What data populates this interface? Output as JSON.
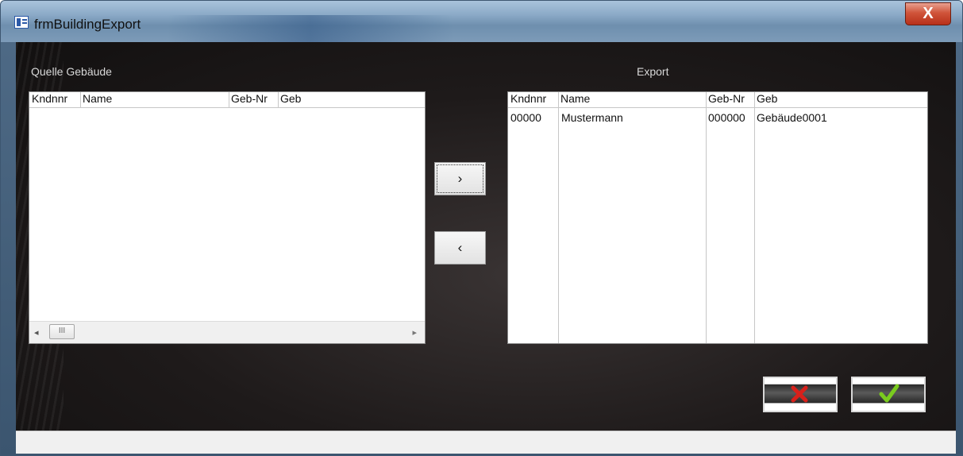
{
  "window": {
    "title": "frmBuildingExport",
    "close_symbol": "X"
  },
  "source": {
    "label": "Quelle Gebäude",
    "columns": [
      "Kndnnr",
      "Name",
      "Geb-Nr",
      "Geb"
    ],
    "rows": [],
    "scrollbar": {
      "left_arrow": "◂",
      "thumb": "III",
      "right_arrow": "▸"
    }
  },
  "export": {
    "label": "Export",
    "columns": [
      "Kndnnr",
      "Name",
      "Geb-Nr",
      "Geb"
    ],
    "rows": [
      {
        "kndnnr": "00000",
        "name": "Mustermann",
        "geb_nr": "000000",
        "geb": "Gebäude0001"
      }
    ]
  },
  "buttons": {
    "move_right": "›",
    "move_left": "‹",
    "cancel_icon": "cancel-x-icon",
    "ok_icon": "checkmark-icon"
  },
  "colors": {
    "cancel_red": "#d8201a",
    "ok_green": "#7acb1e"
  }
}
